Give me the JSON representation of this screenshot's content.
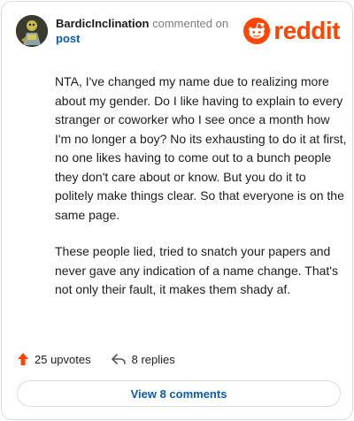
{
  "header": {
    "username": "BardicInclination",
    "action": "commented on",
    "post_link": "post",
    "brand": "reddit"
  },
  "comment": {
    "paragraphs": [
      "NTA, I've changed my name due to realizing more about my gender. Do I like having to explain to every stranger or coworker who I see once a month how I'm no longer a boy? No its exhausting to do it at first, no one likes having to come out to a bunch people they don't care about or know. But you do it to politely make things clear. So that everyone is on the same page.",
      "These people lied, tried to snatch your papers and never gave any indication of a name change. That's not only their fault, it makes them shady af."
    ]
  },
  "footer": {
    "upvotes": "25 upvotes",
    "replies": "8 replies",
    "view_comments": "View 8 comments"
  },
  "colors": {
    "brand": "#ff4500",
    "link": "#0b5cad",
    "upvote": "#ff4500"
  },
  "icons": [
    "avatar",
    "reddit-snoo-icon",
    "upvote-arrow-icon",
    "reply-arrow-icon"
  ]
}
